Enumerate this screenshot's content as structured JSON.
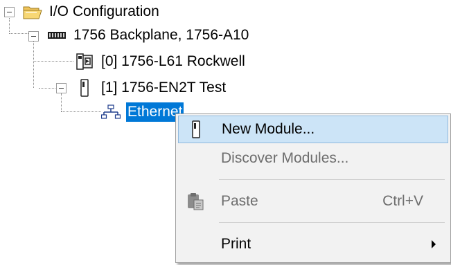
{
  "tree": {
    "root": {
      "label": "I/O Configuration",
      "icon": "folder-icon"
    },
    "backplane": {
      "label": "1756 Backplane, 1756-A10",
      "icon": "backplane-icon"
    },
    "controller": {
      "label": "[0] 1756-L61 Rockwell",
      "icon": "controller-icon"
    },
    "enet_module": {
      "label": "[1] 1756-EN2T Test",
      "icon": "module-icon"
    },
    "network": {
      "label": "Ethernet",
      "icon": "network-icon"
    }
  },
  "context_menu": {
    "items": [
      {
        "label": "New Module...",
        "icon": "module-icon",
        "state": "highlighted"
      },
      {
        "label": "Discover Modules...",
        "state": "disabled"
      },
      {
        "label": "Paste",
        "shortcut": "Ctrl+V",
        "icon": "clipboard-paste-icon",
        "state": "disabled"
      },
      {
        "label": "Print",
        "submenu": true,
        "state": "enabled"
      }
    ]
  },
  "colors": {
    "selection": "#0078d7",
    "menu_background": "#f2f2f2",
    "menu_hover": "#cce4f7",
    "disabled_text": "#6d6d6d"
  }
}
